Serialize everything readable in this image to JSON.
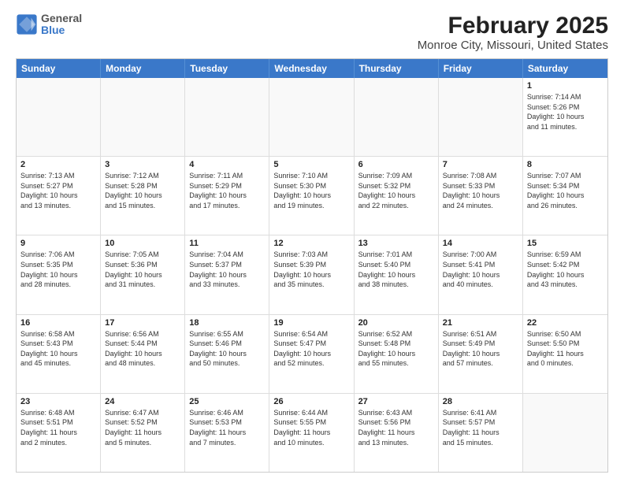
{
  "header": {
    "logo": {
      "line1": "General",
      "line2": "Blue"
    },
    "title": "February 2025",
    "subtitle": "Monroe City, Missouri, United States"
  },
  "weekdays": [
    "Sunday",
    "Monday",
    "Tuesday",
    "Wednesday",
    "Thursday",
    "Friday",
    "Saturday"
  ],
  "rows": [
    {
      "cells": [
        {
          "day": "",
          "empty": true
        },
        {
          "day": "",
          "empty": true
        },
        {
          "day": "",
          "empty": true
        },
        {
          "day": "",
          "empty": true
        },
        {
          "day": "",
          "empty": true
        },
        {
          "day": "",
          "empty": true
        },
        {
          "day": "1",
          "lines": [
            "Sunrise: 7:14 AM",
            "Sunset: 5:26 PM",
            "Daylight: 10 hours",
            "and 11 minutes."
          ]
        }
      ]
    },
    {
      "cells": [
        {
          "day": "2",
          "lines": [
            "Sunrise: 7:13 AM",
            "Sunset: 5:27 PM",
            "Daylight: 10 hours",
            "and 13 minutes."
          ]
        },
        {
          "day": "3",
          "lines": [
            "Sunrise: 7:12 AM",
            "Sunset: 5:28 PM",
            "Daylight: 10 hours",
            "and 15 minutes."
          ]
        },
        {
          "day": "4",
          "lines": [
            "Sunrise: 7:11 AM",
            "Sunset: 5:29 PM",
            "Daylight: 10 hours",
            "and 17 minutes."
          ]
        },
        {
          "day": "5",
          "lines": [
            "Sunrise: 7:10 AM",
            "Sunset: 5:30 PM",
            "Daylight: 10 hours",
            "and 19 minutes."
          ]
        },
        {
          "day": "6",
          "lines": [
            "Sunrise: 7:09 AM",
            "Sunset: 5:32 PM",
            "Daylight: 10 hours",
            "and 22 minutes."
          ]
        },
        {
          "day": "7",
          "lines": [
            "Sunrise: 7:08 AM",
            "Sunset: 5:33 PM",
            "Daylight: 10 hours",
            "and 24 minutes."
          ]
        },
        {
          "day": "8",
          "lines": [
            "Sunrise: 7:07 AM",
            "Sunset: 5:34 PM",
            "Daylight: 10 hours",
            "and 26 minutes."
          ]
        }
      ]
    },
    {
      "cells": [
        {
          "day": "9",
          "lines": [
            "Sunrise: 7:06 AM",
            "Sunset: 5:35 PM",
            "Daylight: 10 hours",
            "and 28 minutes."
          ]
        },
        {
          "day": "10",
          "lines": [
            "Sunrise: 7:05 AM",
            "Sunset: 5:36 PM",
            "Daylight: 10 hours",
            "and 31 minutes."
          ]
        },
        {
          "day": "11",
          "lines": [
            "Sunrise: 7:04 AM",
            "Sunset: 5:37 PM",
            "Daylight: 10 hours",
            "and 33 minutes."
          ]
        },
        {
          "day": "12",
          "lines": [
            "Sunrise: 7:03 AM",
            "Sunset: 5:39 PM",
            "Daylight: 10 hours",
            "and 35 minutes."
          ]
        },
        {
          "day": "13",
          "lines": [
            "Sunrise: 7:01 AM",
            "Sunset: 5:40 PM",
            "Daylight: 10 hours",
            "and 38 minutes."
          ]
        },
        {
          "day": "14",
          "lines": [
            "Sunrise: 7:00 AM",
            "Sunset: 5:41 PM",
            "Daylight: 10 hours",
            "and 40 minutes."
          ]
        },
        {
          "day": "15",
          "lines": [
            "Sunrise: 6:59 AM",
            "Sunset: 5:42 PM",
            "Daylight: 10 hours",
            "and 43 minutes."
          ]
        }
      ]
    },
    {
      "cells": [
        {
          "day": "16",
          "lines": [
            "Sunrise: 6:58 AM",
            "Sunset: 5:43 PM",
            "Daylight: 10 hours",
            "and 45 minutes."
          ]
        },
        {
          "day": "17",
          "lines": [
            "Sunrise: 6:56 AM",
            "Sunset: 5:44 PM",
            "Daylight: 10 hours",
            "and 48 minutes."
          ]
        },
        {
          "day": "18",
          "lines": [
            "Sunrise: 6:55 AM",
            "Sunset: 5:46 PM",
            "Daylight: 10 hours",
            "and 50 minutes."
          ]
        },
        {
          "day": "19",
          "lines": [
            "Sunrise: 6:54 AM",
            "Sunset: 5:47 PM",
            "Daylight: 10 hours",
            "and 52 minutes."
          ]
        },
        {
          "day": "20",
          "lines": [
            "Sunrise: 6:52 AM",
            "Sunset: 5:48 PM",
            "Daylight: 10 hours",
            "and 55 minutes."
          ]
        },
        {
          "day": "21",
          "lines": [
            "Sunrise: 6:51 AM",
            "Sunset: 5:49 PM",
            "Daylight: 10 hours",
            "and 57 minutes."
          ]
        },
        {
          "day": "22",
          "lines": [
            "Sunrise: 6:50 AM",
            "Sunset: 5:50 PM",
            "Daylight: 11 hours",
            "and 0 minutes."
          ]
        }
      ]
    },
    {
      "cells": [
        {
          "day": "23",
          "lines": [
            "Sunrise: 6:48 AM",
            "Sunset: 5:51 PM",
            "Daylight: 11 hours",
            "and 2 minutes."
          ]
        },
        {
          "day": "24",
          "lines": [
            "Sunrise: 6:47 AM",
            "Sunset: 5:52 PM",
            "Daylight: 11 hours",
            "and 5 minutes."
          ]
        },
        {
          "day": "25",
          "lines": [
            "Sunrise: 6:46 AM",
            "Sunset: 5:53 PM",
            "Daylight: 11 hours",
            "and 7 minutes."
          ]
        },
        {
          "day": "26",
          "lines": [
            "Sunrise: 6:44 AM",
            "Sunset: 5:55 PM",
            "Daylight: 11 hours",
            "and 10 minutes."
          ]
        },
        {
          "day": "27",
          "lines": [
            "Sunrise: 6:43 AM",
            "Sunset: 5:56 PM",
            "Daylight: 11 hours",
            "and 13 minutes."
          ]
        },
        {
          "day": "28",
          "lines": [
            "Sunrise: 6:41 AM",
            "Sunset: 5:57 PM",
            "Daylight: 11 hours",
            "and 15 minutes."
          ]
        },
        {
          "day": "",
          "empty": true
        }
      ]
    }
  ]
}
